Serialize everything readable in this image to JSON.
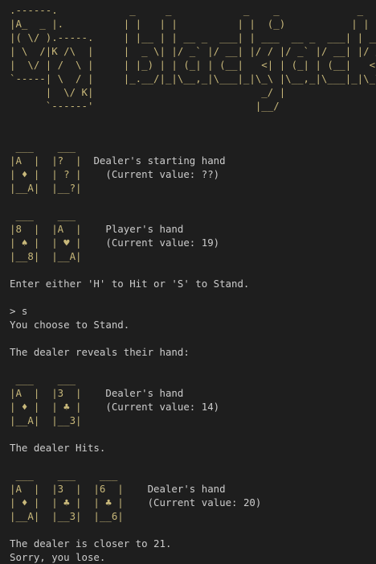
{
  "logo_art": ".------.            _     _            _    _             _\n|A_  _ |.          | |   | |          | |  (_)           | |\n|( \\/ ).-----.     | |__ | | __ _  ___| | ___  __ _  ___| | __\n| \\  /|K /\\  |     |  _ \\| |/ _` |/ __| |/ / |/ _` |/ __| |/ /\n|  \\/ | /  \\ |     | |_) | | (_| | (__|   <| | (_| | (__|   <\n`-----| \\  / |     |_.__/|_|\\__,_|\\___|_|\\_\\ |\\__,_|\\___|_|\\_\\\n      |  \\/ K|                            _/ |\n      `------'                           |__/",
  "initial_deal": {
    "dealer": {
      "cards": [
        " ___    ___",
        "|A  |  |?  |",
        "| ♦ |  | ? |",
        "|__A|  |__?|"
      ],
      "labels": [
        "",
        "Dealer's starting hand",
        "  (Current value: ??)",
        ""
      ]
    },
    "player": {
      "cards": [
        " ___    ___",
        "|8  |  |A  |",
        "| ♠ |  | ♥ |",
        "|__8|  |__A|"
      ],
      "labels": [
        "",
        "  Player's hand",
        "  (Current value: 19)",
        ""
      ]
    }
  },
  "prompt_text": "Enter either 'H' to Hit or 'S' to Stand.",
  "user_input": "> s",
  "choice_message": "You choose to Stand.",
  "reveal_message": "The dealer reveals their hand:",
  "dealer_reveal": {
    "cards": [
      " ___    ___",
      "|A  |  |3  |",
      "| ♦ |  | ♣ |",
      "|__A|  |__3|"
    ],
    "labels": [
      "",
      "  Dealer's hand",
      "  (Current value: 14)",
      ""
    ]
  },
  "hit_message": "The dealer Hits.",
  "dealer_final": {
    "cards": [
      " ___    ___    ___",
      "|A  |  |3  |  |6  |",
      "| ♦ |  | ♣ |  | ♣ |",
      "|__A|  |__3|  |__6|"
    ],
    "labels": [
      "",
      "  Dealer's hand",
      "  (Current value: 20)",
      ""
    ]
  },
  "result_message": "The dealer is closer to 21.",
  "lose_message": "Sorry, you lose."
}
